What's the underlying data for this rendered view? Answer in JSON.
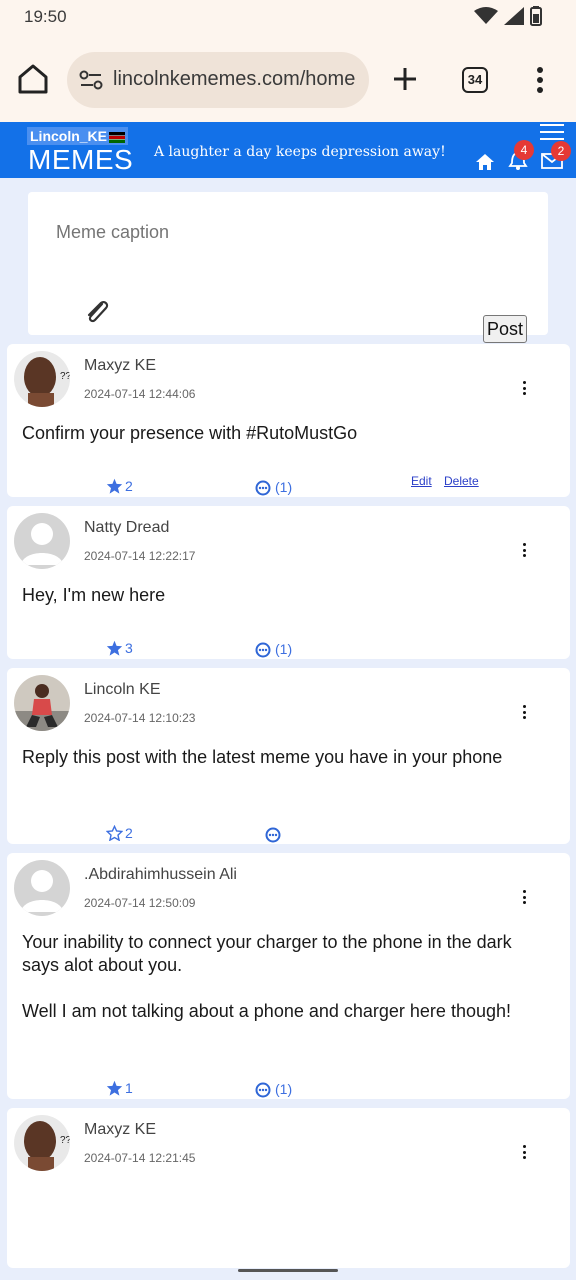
{
  "status_bar": {
    "time": "19:50",
    "icons": [
      "wifi-icon",
      "signal-icon",
      "battery-icon"
    ]
  },
  "browser": {
    "url": "lincolnkememes.com/home",
    "tab_count": "34"
  },
  "site": {
    "logo_top": "Lincoln_KE",
    "logo_bottom": "MEMES",
    "tagline": "A laughter a day keeps depression away!",
    "notifications_count": "4",
    "messages_count": "2",
    "brand_color": "#1371e8"
  },
  "composer": {
    "placeholder": "Meme caption",
    "post_label": "Post"
  },
  "posts": [
    {
      "author": "Maxyz KE",
      "datetime": "2024-07-14 12:44:06",
      "paragraphs": [
        "Confirm your presence with #RutoMustGo"
      ],
      "stars": "2",
      "star_filled": true,
      "comments": "(1)",
      "edit_label": "Edit",
      "delete_label": "Delete"
    },
    {
      "author": "Natty Dread",
      "datetime": "2024-07-14 12:22:17",
      "paragraphs": [
        "Hey, I'm new here"
      ],
      "stars": "3",
      "star_filled": true,
      "comments": "(1)"
    },
    {
      "author": "Lincoln KE",
      "datetime": "2024-07-14 12:10:23",
      "paragraphs": [
        "Reply this post with the latest meme you have in your phone"
      ],
      "stars": "2",
      "star_filled": false,
      "comments": ""
    },
    {
      "author": ".Abdirahimhussein Ali",
      "datetime": "2024-07-14 12:50:09",
      "paragraphs": [
        "Your inability to connect your charger to the phone in the dark says alot about you.",
        "Well I am not talking about a phone and charger here though!"
      ],
      "stars": "1",
      "star_filled": true,
      "comments": "(1)"
    },
    {
      "author": "Maxyz KE",
      "datetime": "2024-07-14 12:21:45",
      "paragraphs": []
    }
  ]
}
